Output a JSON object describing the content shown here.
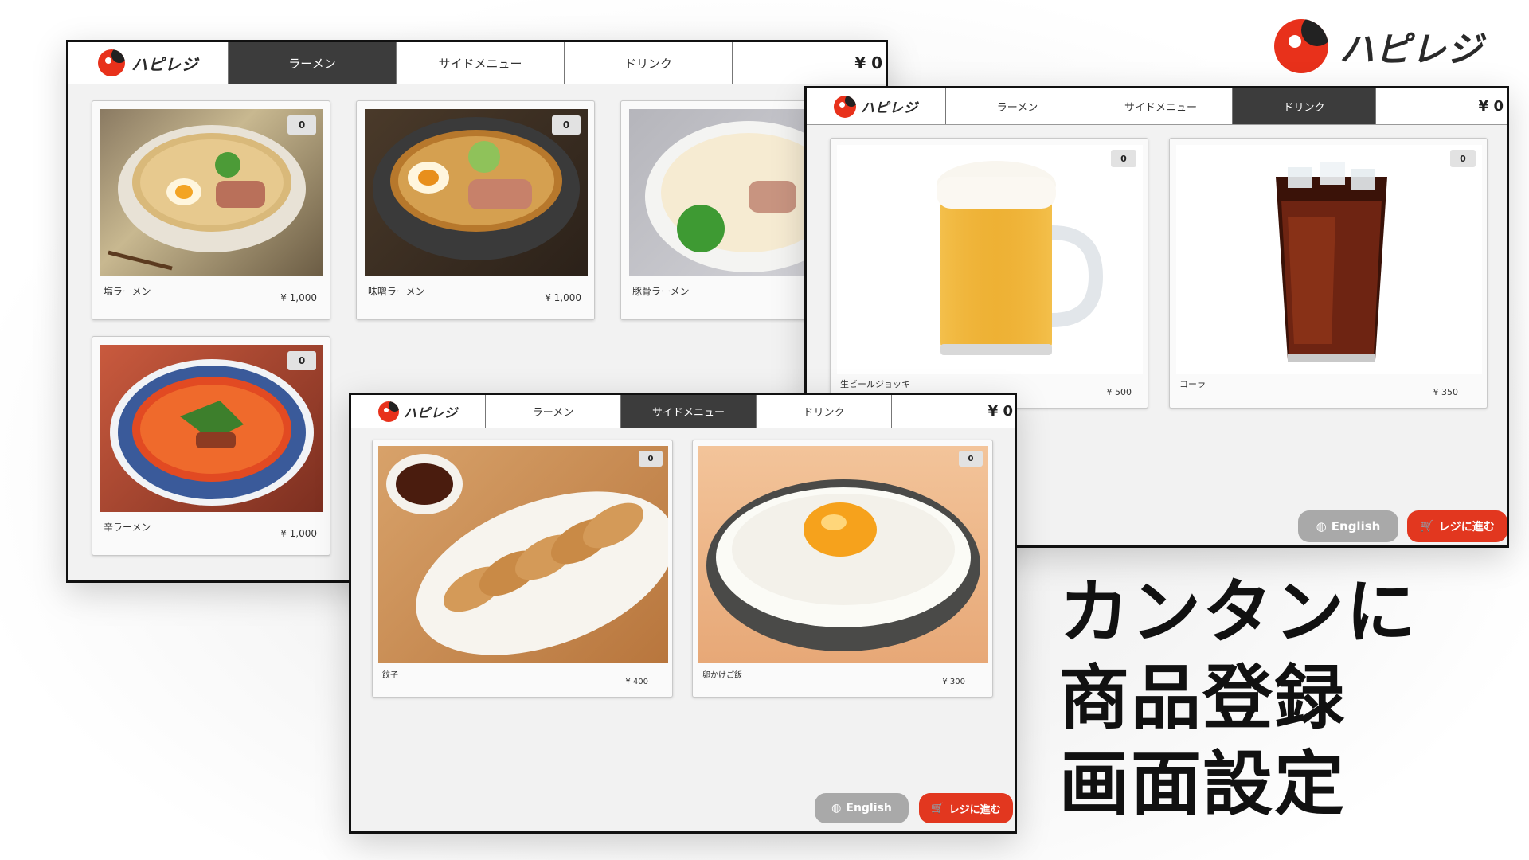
{
  "brand": {
    "logo_text": "ハピレジ",
    "accent": "#e8311b",
    "dark_tab": "#3c3c3c"
  },
  "tagline": [
    "カンタンに",
    "商品登録",
    "画面設定"
  ],
  "windows": {
    "ramen": {
      "tabs": [
        "ラーメン",
        "サイドメニュー",
        "ドリンク"
      ],
      "active_tab": "ラーメン",
      "total": "¥ 0",
      "items": [
        {
          "name": "塩ラーメン",
          "price": "¥ 1,000",
          "qty": "0"
        },
        {
          "name": "味噌ラーメン",
          "price": "¥ 1,000",
          "qty": "0"
        },
        {
          "name": "豚骨ラーメン",
          "price": "",
          "qty": ""
        },
        {
          "name": "辛ラーメン",
          "price": "¥ 1,000",
          "qty": "0"
        }
      ]
    },
    "drink": {
      "tabs": [
        "ラーメン",
        "サイドメニュー",
        "ドリンク"
      ],
      "active_tab": "ドリンク",
      "total": "¥ 0",
      "items": [
        {
          "name": "生ビールジョッキ",
          "price": "¥ 500",
          "qty": "0"
        },
        {
          "name": "コーラ",
          "price": "¥ 350",
          "qty": "0"
        }
      ],
      "english_label": "English",
      "checkout_label": "レジに進む"
    },
    "side": {
      "tabs": [
        "ラーメン",
        "サイドメニュー",
        "ドリンク"
      ],
      "active_tab": "サイドメニュー",
      "total": "¥ 0",
      "items": [
        {
          "name": "餃子",
          "price": "¥ 400",
          "qty": "0"
        },
        {
          "name": "卵かけご飯",
          "price": "¥ 300",
          "qty": "0"
        }
      ],
      "english_label": "English",
      "checkout_label": "レジに進む"
    }
  }
}
